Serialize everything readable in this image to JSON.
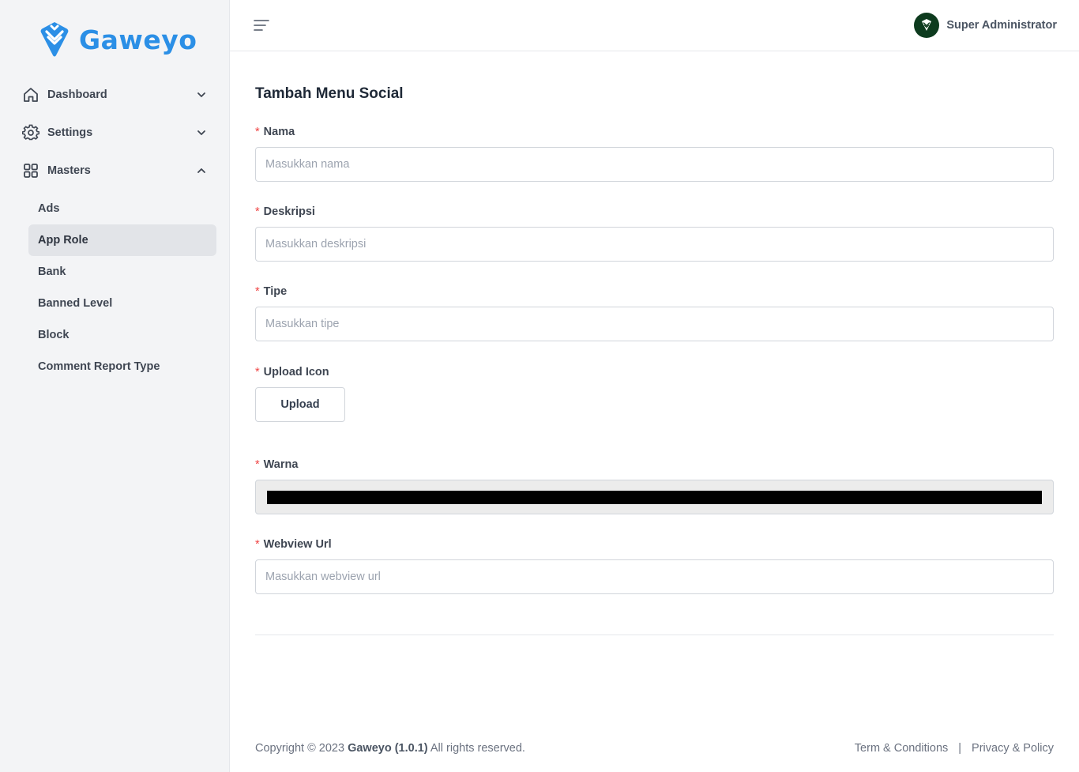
{
  "brand": {
    "name": "Gaweyo",
    "color": "#2b8fe6"
  },
  "sidebar": {
    "items": [
      {
        "label": "Dashboard",
        "icon": "home-icon",
        "expanded": false
      },
      {
        "label": "Settings",
        "icon": "gear-icon",
        "expanded": false
      },
      {
        "label": "Masters",
        "icon": "grid-icon",
        "expanded": true
      }
    ],
    "sub_items": [
      "Ads",
      "App Role",
      "Bank",
      "Banned Level",
      "Block",
      "Comment Report Type"
    ],
    "active_sub_item": "App Role"
  },
  "header": {
    "user_name": "Super Administrator"
  },
  "page": {
    "title": "Tambah Menu Social"
  },
  "form": {
    "nama": {
      "label": "Nama",
      "placeholder": "Masukkan nama",
      "value": ""
    },
    "deskripsi": {
      "label": "Deskripsi",
      "placeholder": "Masukkan deskripsi",
      "value": ""
    },
    "tipe": {
      "label": "Tipe",
      "placeholder": "Masukkan tipe",
      "value": ""
    },
    "upload_icon": {
      "label": "Upload Icon",
      "button_label": "Upload"
    },
    "warna": {
      "label": "Warna",
      "value": "#000000"
    },
    "webview_url": {
      "label": "Webview Url",
      "placeholder": "Masukkan webview url",
      "value": ""
    },
    "required_mark": "*"
  },
  "footer": {
    "copyright_prefix": "Copyright © 2023",
    "app_version": "Gaweyo (1.0.1)",
    "copyright_suffix": "All rights reserved.",
    "links": [
      "Term & Conditions",
      "Privacy & Policy"
    ],
    "separator": "|"
  }
}
